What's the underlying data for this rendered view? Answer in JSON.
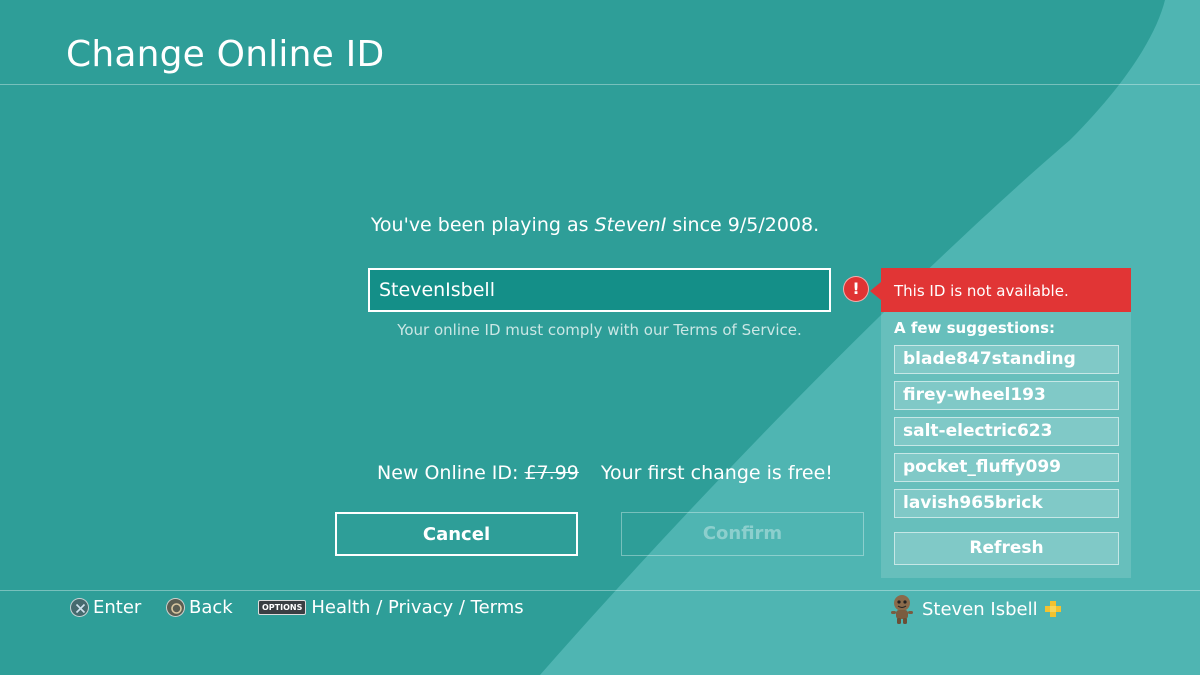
{
  "header": {
    "title": "Change Online ID"
  },
  "account": {
    "prefix": "You've been playing as ",
    "current_id": "StevenI",
    "since_text": " since 9/5/2008."
  },
  "id_field": {
    "value": "StevenIsbell",
    "note": "Your online ID must comply with our Terms of Service."
  },
  "error": {
    "icon": "!",
    "message": "This ID is not available."
  },
  "suggestions": {
    "heading": "A few suggestions:",
    "items": [
      "blade847standing",
      "firey-wheel193",
      "salt-electric623",
      "pocket_fluffy099",
      "lavish965brick"
    ],
    "refresh_label": "Refresh"
  },
  "pricing": {
    "label": "New Online ID: ",
    "old_price": "£7.99",
    "free_note": "Your first change is free!"
  },
  "buttons": {
    "cancel": "Cancel",
    "confirm": "Confirm"
  },
  "footer": {
    "enter_label": "Enter",
    "back_label": "Back",
    "options_key": "OPTIONS",
    "links_label": "Health / Privacy / Terms",
    "username": "Steven Isbell"
  },
  "colors": {
    "background": "#2e9e98",
    "background_light": "#4fb5b2",
    "input_fill": "#148f88",
    "error_red": "#e13535",
    "plus_gold": "#f2c230"
  },
  "icons": {
    "enter": "cross-button-icon",
    "back": "circle-button-icon",
    "options": "options-button-icon",
    "avatar": "sackboy-avatar-icon",
    "plus": "playstation-plus-icon",
    "error": "exclamation-icon"
  }
}
